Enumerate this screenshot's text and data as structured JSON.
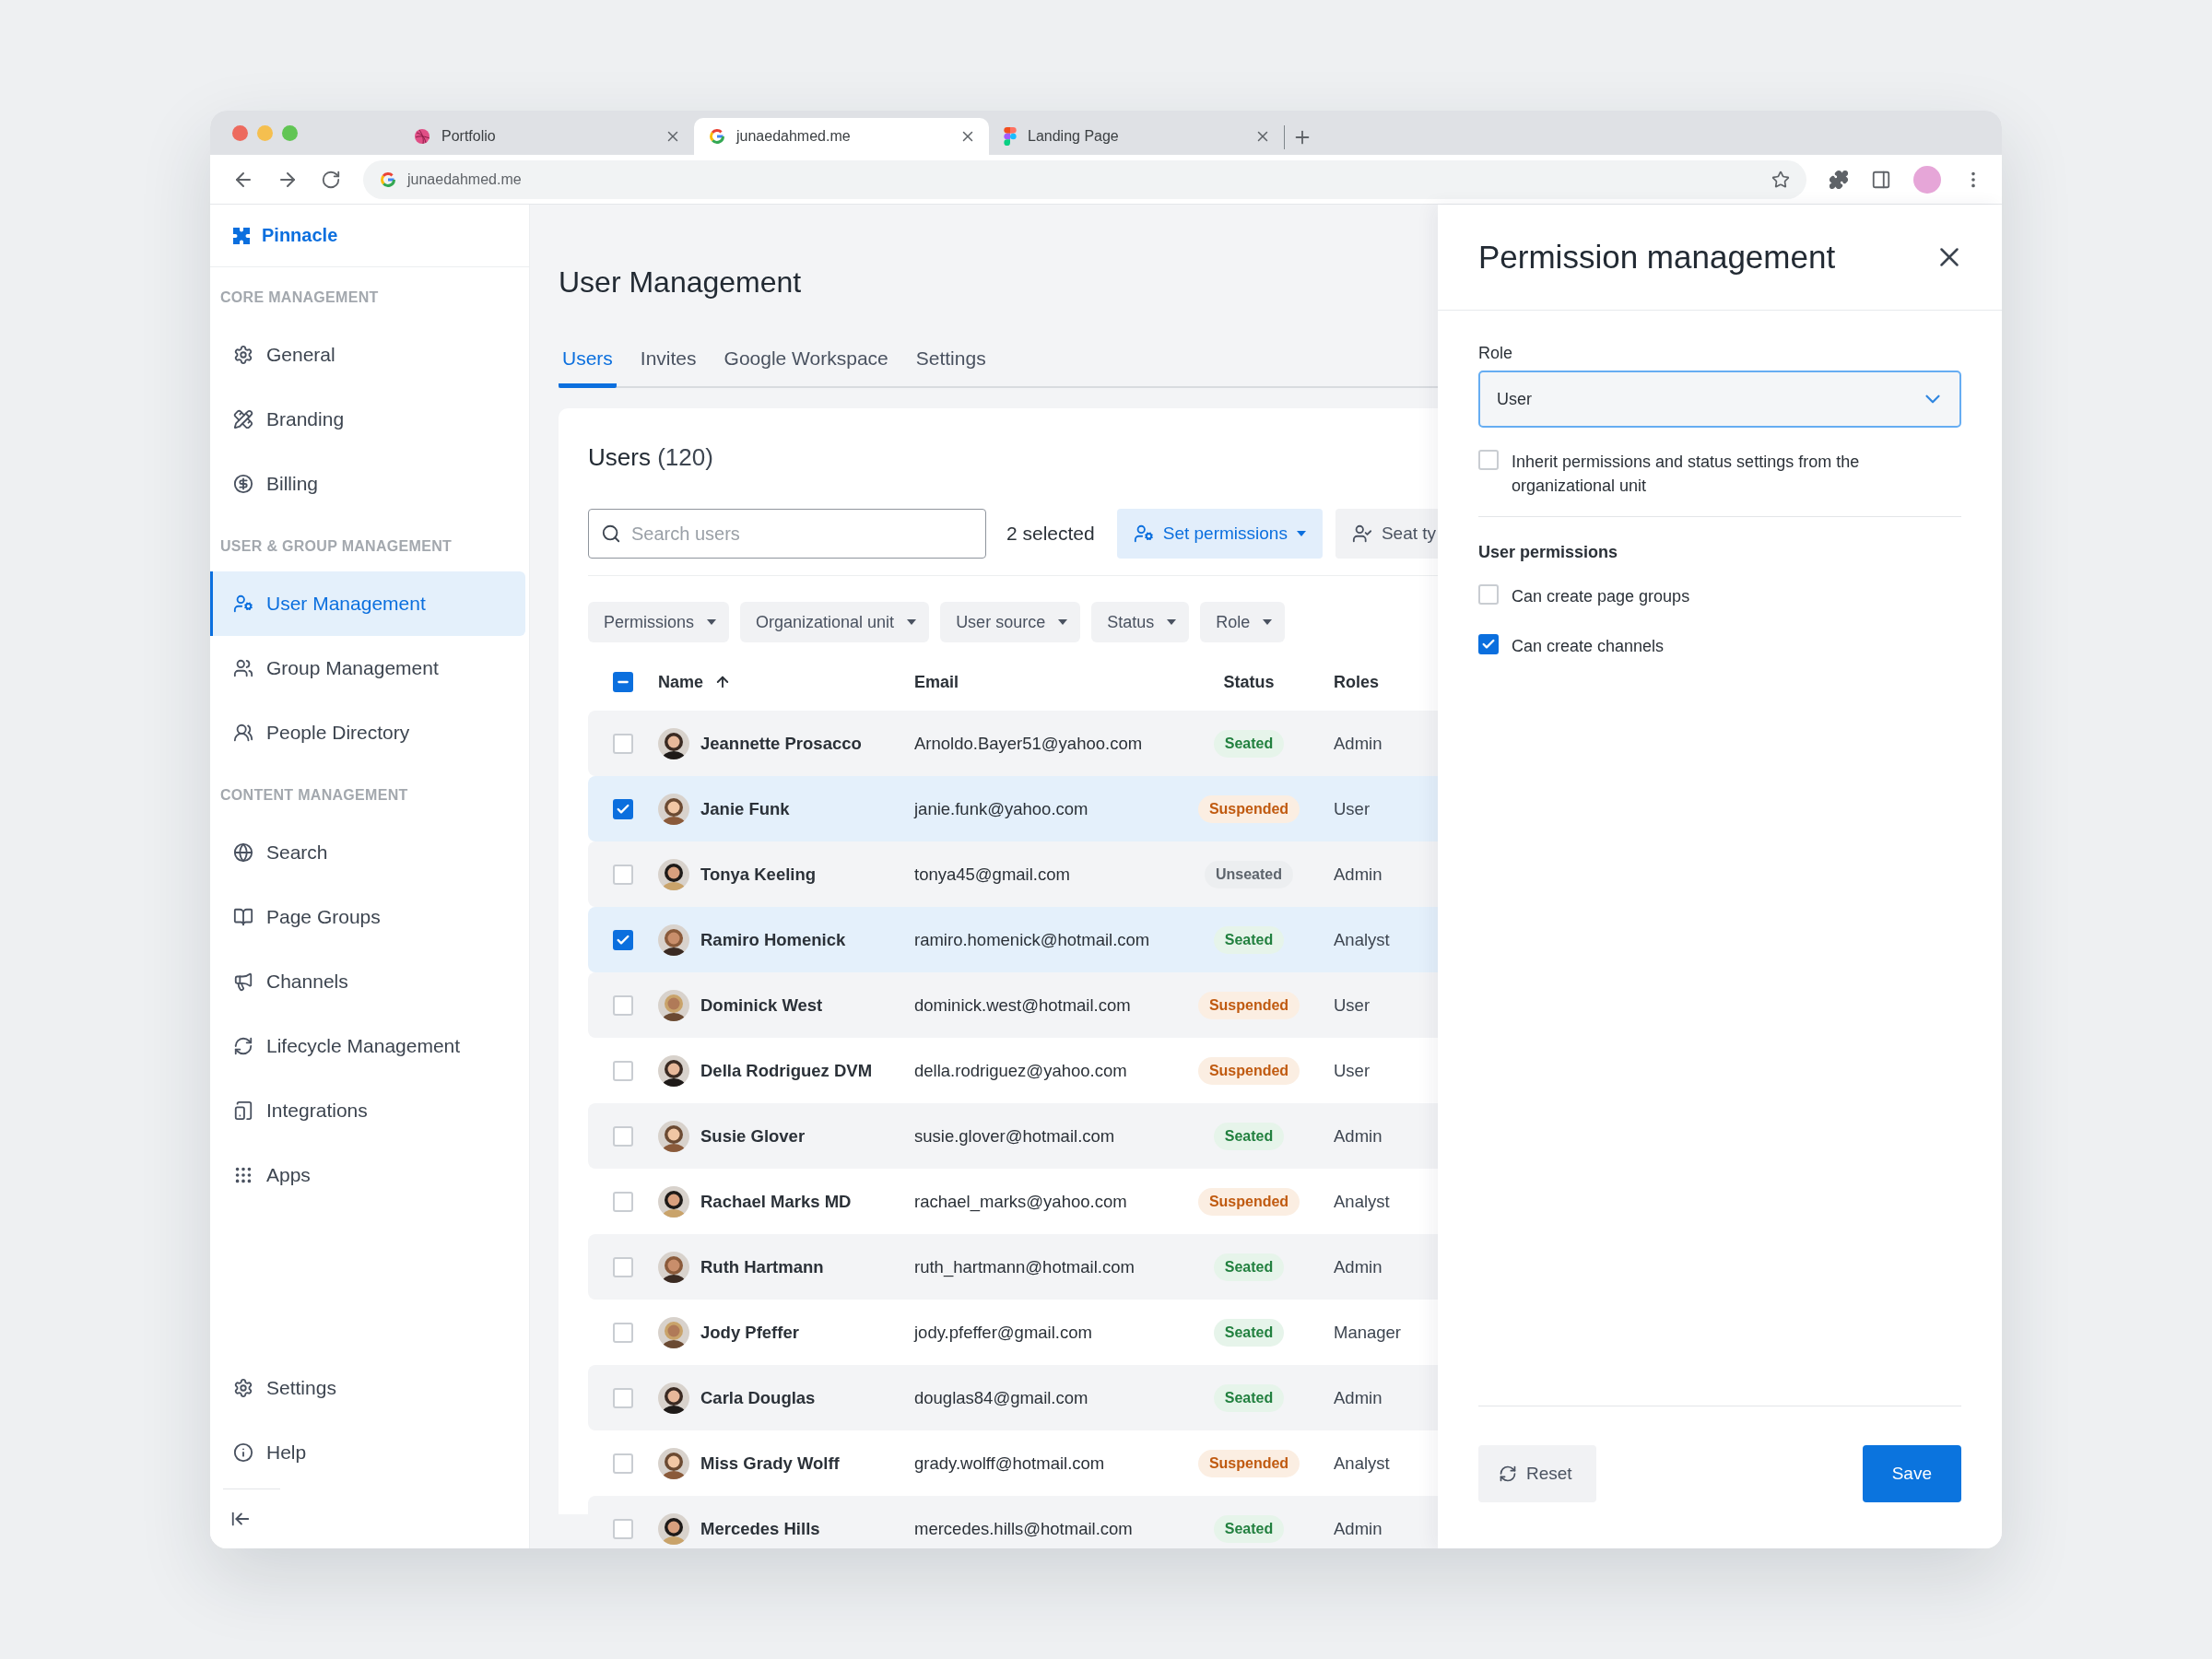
{
  "browser": {
    "tabs": [
      {
        "title": "Portfolio",
        "selected": false
      },
      {
        "title": "junaedahmed.me",
        "selected": true
      },
      {
        "title": "Landing Page",
        "selected": false
      }
    ],
    "address": "junaedahmed.me"
  },
  "sidebar": {
    "brand": "Pinnacle",
    "sections": [
      {
        "heading": "CORE MANAGEMENT",
        "items": [
          {
            "label": "General",
            "selected": false
          },
          {
            "label": "Branding",
            "selected": false
          },
          {
            "label": "Billing",
            "selected": false
          }
        ]
      },
      {
        "heading": "USER & GROUP MANAGEMENT",
        "items": [
          {
            "label": "User Management",
            "selected": true
          },
          {
            "label": "Group Management",
            "selected": false
          },
          {
            "label": "People Directory",
            "selected": false
          }
        ]
      },
      {
        "heading": "CONTENT MANAGEMENT",
        "items": [
          {
            "label": "Search",
            "selected": false
          },
          {
            "label": "Page Groups",
            "selected": false
          },
          {
            "label": "Channels",
            "selected": false
          },
          {
            "label": "Lifecycle Management",
            "selected": false
          },
          {
            "label": "Integrations",
            "selected": false
          },
          {
            "label": "Apps",
            "selected": false
          }
        ]
      }
    ],
    "footer_items": [
      {
        "label": "Settings",
        "selected": false
      },
      {
        "label": "Help",
        "selected": false
      }
    ]
  },
  "page": {
    "title": "User Management",
    "tabs": [
      {
        "label": "Users",
        "selected": true
      },
      {
        "label": "Invites",
        "selected": false
      },
      {
        "label": "Google Workspace",
        "selected": false
      },
      {
        "label": "Settings",
        "selected": false
      }
    ]
  },
  "users_card": {
    "title": "Users",
    "count": "(120)",
    "search": {
      "placeholder": "Search users"
    },
    "selection": "2 selected",
    "actions": [
      {
        "label": "Set permissions",
        "kind": "primary"
      },
      {
        "label": "Seat ty",
        "kind": "secondary"
      }
    ],
    "filters": [
      "Permissions",
      "Organizational unit",
      "User source",
      "Status",
      "Role"
    ],
    "table": {
      "header_checkbox": {
        "indeterminate": true
      },
      "columns": [
        {
          "label": "Name",
          "sorted": true
        },
        {
          "label": "Email",
          "sorted": false
        },
        {
          "label": "Status",
          "sorted": false
        },
        {
          "label": "Roles",
          "sorted": false
        }
      ],
      "rows": [
        {
          "name": "Jeannette Prosacco",
          "email": "Arnoldo.Bayer51@yahoo.com",
          "status": {
            "label": "Seated",
            "kind": "seated"
          },
          "role": "Admin",
          "selected": false
        },
        {
          "name": "Janie Funk",
          "email": "janie.funk@yahoo.com",
          "status": {
            "label": "Suspended",
            "kind": "suspended"
          },
          "role": "User",
          "selected": true
        },
        {
          "name": "Tonya Keeling",
          "email": "tonya45@gmail.com",
          "status": {
            "label": "Unseated",
            "kind": "unseated"
          },
          "role": "Admin",
          "selected": false
        },
        {
          "name": "Ramiro Homenick",
          "email": "ramiro.homenick@hotmail.com",
          "status": {
            "label": "Seated",
            "kind": "seated"
          },
          "role": "Analyst",
          "selected": true
        },
        {
          "name": "Dominick West",
          "email": "dominick.west@hotmail.com",
          "status": {
            "label": "Suspended",
            "kind": "suspended"
          },
          "role": "User",
          "selected": false
        },
        {
          "name": "Della Rodriguez DVM",
          "email": "della.rodriguez@yahoo.com",
          "status": {
            "label": "Suspended",
            "kind": "suspended"
          },
          "role": "User",
          "selected": false
        },
        {
          "name": "Susie Glover",
          "email": "susie.glover@hotmail.com",
          "status": {
            "label": "Seated",
            "kind": "seated"
          },
          "role": "Admin",
          "selected": false
        },
        {
          "name": "Rachael Marks MD",
          "email": "rachael_marks@yahoo.com",
          "status": {
            "label": "Suspended",
            "kind": "suspended"
          },
          "role": "Analyst",
          "selected": false
        },
        {
          "name": "Ruth Hartmann",
          "email": "ruth_hartmann@hotmail.com",
          "status": {
            "label": "Seated",
            "kind": "seated"
          },
          "role": "Admin",
          "selected": false
        },
        {
          "name": "Jody Pfeffer",
          "email": "jody.pfeffer@gmail.com",
          "status": {
            "label": "Seated",
            "kind": "seated"
          },
          "role": "Manager",
          "selected": false
        },
        {
          "name": "Carla Douglas",
          "email": "douglas84@gmail.com",
          "status": {
            "label": "Seated",
            "kind": "seated"
          },
          "role": "Admin",
          "selected": false
        },
        {
          "name": "Miss Grady Wolff",
          "email": "grady.wolff@hotmail.com",
          "status": {
            "label": "Suspended",
            "kind": "suspended"
          },
          "role": "Analyst",
          "selected": false
        },
        {
          "name": "Mercedes Hills",
          "email": "mercedes.hills@hotmail.com",
          "status": {
            "label": "Seated",
            "kind": "seated"
          },
          "role": "Admin",
          "selected": false
        }
      ]
    }
  },
  "panel": {
    "title": "Permission management",
    "role": {
      "label": "Role",
      "value": "User"
    },
    "inherit": {
      "label": "Inherit permissions and status settings from the organizational unit",
      "checked": false
    },
    "permissions_heading": "User permissions",
    "permissions": [
      {
        "label": "Can create page groups",
        "checked": false
      },
      {
        "label": "Can create channels",
        "checked": true
      }
    ],
    "buttons": [
      {
        "label": "Reset",
        "kind": "secondary"
      },
      {
        "label": "Save",
        "kind": "primary"
      }
    ]
  }
}
